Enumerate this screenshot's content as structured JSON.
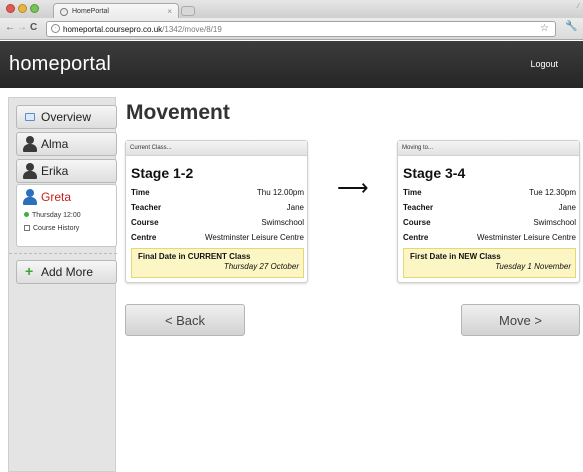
{
  "browser": {
    "tab_title": "HomePortal",
    "url_host": "homeportal.coursepro.co.uk",
    "url_path": "/1342/move/8/19"
  },
  "header": {
    "brand": "homeportal",
    "logout": "Logout"
  },
  "sidebar": {
    "items": [
      {
        "label": "Overview",
        "icon": "overview-icon"
      },
      {
        "label": "Alma",
        "icon": "person-icon"
      },
      {
        "label": "Erika",
        "icon": "person-icon"
      }
    ],
    "selected": {
      "name": "Greta",
      "lesson": "Thursday 12:00",
      "history": "Course History",
      "name_color": "#c8201c"
    },
    "add_more": "Add More"
  },
  "main": {
    "title": "Movement",
    "current": {
      "heading": "Current Class...",
      "stage": "Stage 1-2",
      "rows": [
        {
          "label": "Time",
          "value": "Thu 12.00pm"
        },
        {
          "label": "Teacher",
          "value": "Jane"
        },
        {
          "label": "Course",
          "value": "Swimschool"
        },
        {
          "label": "Centre",
          "value": "Westminster Leisure Centre"
        }
      ],
      "note_title": "Final Date in CURRENT Class",
      "note_date": "Thursday 27 October"
    },
    "arrow": "⟶",
    "next": {
      "heading": "Moving to...",
      "stage": "Stage 3-4",
      "rows": [
        {
          "label": "Time",
          "value": "Tue 12.30pm"
        },
        {
          "label": "Teacher",
          "value": "Jane"
        },
        {
          "label": "Course",
          "value": "Swimschool"
        },
        {
          "label": "Centre",
          "value": "Westminster Leisure Centre"
        }
      ],
      "note_title": "First Date in NEW Class",
      "note_date": "Tuesday 1 November"
    },
    "back_button": "< Back",
    "move_button": "Move >"
  },
  "colors": {
    "header_bg": "#2e2e2e",
    "note_bg": "#fbf6c3",
    "add_icon": "#3fa33a"
  }
}
